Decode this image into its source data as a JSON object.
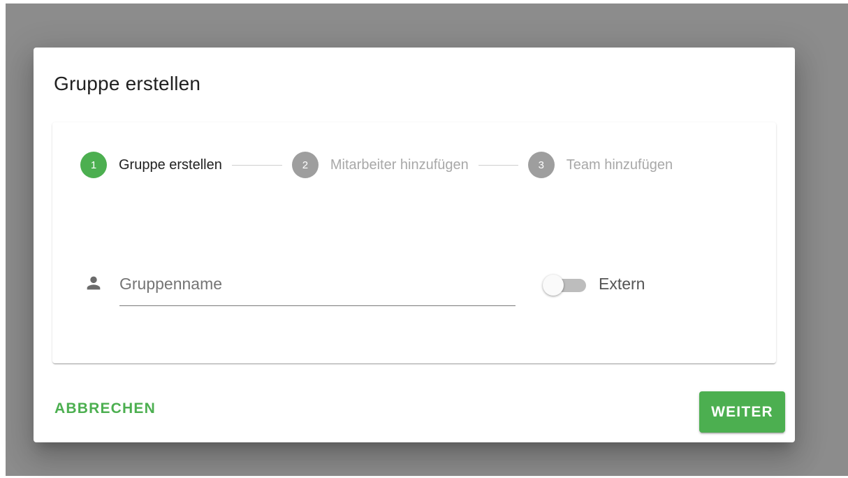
{
  "dialog": {
    "title": "Gruppe erstellen"
  },
  "stepper": {
    "steps": [
      {
        "number": "1",
        "label": "Gruppe erstellen",
        "state": "active"
      },
      {
        "number": "2",
        "label": "Mitarbeiter hinzufügen",
        "state": "inactive"
      },
      {
        "number": "3",
        "label": "Team hinzufügen",
        "state": "inactive"
      }
    ]
  },
  "form": {
    "group_name": {
      "value": "",
      "placeholder": "Gruppenname",
      "icon": "person-icon"
    },
    "extern_toggle": {
      "label": "Extern",
      "checked": false
    }
  },
  "actions": {
    "cancel_label": "ABBRECHEN",
    "next_label": "WEITER"
  },
  "colors": {
    "primary": "#4caf50",
    "inactive_step": "#9e9e9e",
    "overlay": "#8c8c8c"
  }
}
